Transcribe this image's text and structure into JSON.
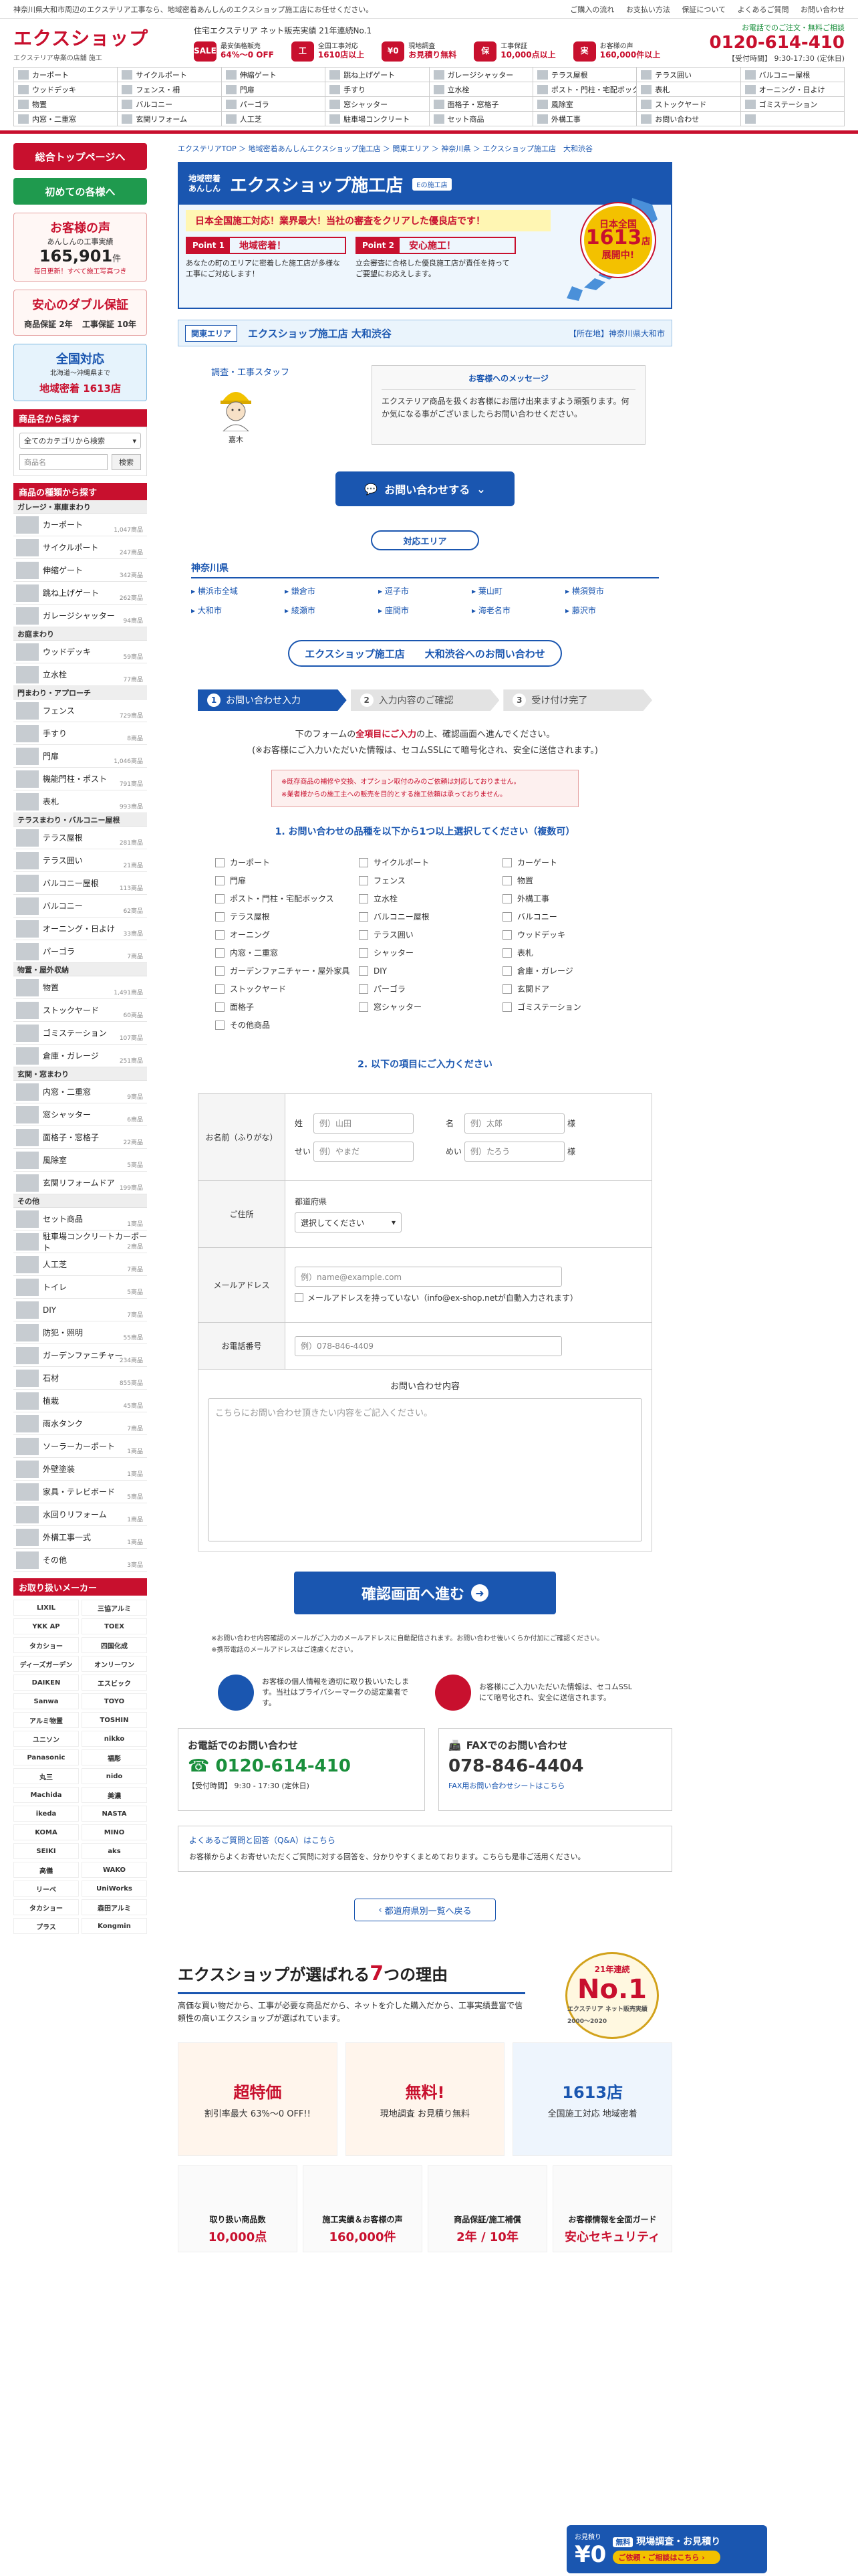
{
  "topbar": {
    "notice": "神奈川県大和市周辺のエクステリア工事なら、地域密着あんしんのエクスショップ施工店にお任せください。",
    "links": [
      "ご購入の流れ",
      "お支払い方法",
      "保証について",
      "よくあるご質問",
      "お問い合わせ"
    ]
  },
  "header": {
    "logo": "エクスショップ",
    "tagline": "エクステリア専業の店舗 施工",
    "award_line": "住宅エクステリア ネット販売実績 21年連続No.1",
    "stats": [
      {
        "icon": "SALE",
        "l1": "最安価格販売",
        "l2": "64%～0 OFF"
      },
      {
        "icon": "工",
        "l1": "全国工事対応",
        "l2": "1610店以上"
      },
      {
        "icon": "¥0",
        "l1": "現地調査",
        "l2": "お見積り無料"
      },
      {
        "icon": "保",
        "l1": "工事保証",
        "l2": "10,000点以上"
      },
      {
        "icon": "実",
        "l1": "お客様の声",
        "l2": "160,000件以上"
      }
    ],
    "phone_label": "お電話でのご注文・無料ご相談",
    "phone": "0120-614-410",
    "hours": "【受付時間】 9:30-17:30 (定休日)"
  },
  "catnav": [
    "カーポート",
    "サイクルポート",
    "伸縮ゲート",
    "跳ね上げゲート",
    "ガレージシャッター",
    "テラス屋根",
    "テラス囲い",
    "バルコニー屋根",
    "ウッドデッキ",
    "フェンス・柵",
    "門扉",
    "手すり",
    "立水栓",
    "ポスト・門柱・宅配ボックス",
    "表札",
    "オーニング・日よけ",
    "物置",
    "バルコニー",
    "パーゴラ",
    "窓シャッター",
    "面格子・窓格子",
    "風除室",
    "ストックヤード",
    "ゴミステーション",
    "内窓・二重窓",
    "玄関リフォーム",
    "人工芝",
    "駐車場コンクリート",
    "セット商品",
    "外構工事",
    "お問い合わせ",
    ""
  ],
  "sidebar": {
    "btn_top": "総合トップページへ",
    "btn_first": "初めての各様へ",
    "voice_title": "お客様の声",
    "voice_sub": "あんしんの工事実績",
    "voice_num": "165,901",
    "voice_unit": "件",
    "voice_note": "毎日更新！すべて施工写真つき",
    "guarantee_title": "安心のダブル保証",
    "guarantee_a": "商品保証 2年",
    "guarantee_b": "工事保証 10年",
    "national_title": "全国対応",
    "national_sub": "北海道〜沖縄県まで",
    "national_count": "地域密着 1613店",
    "search_head": "商品名から探す",
    "search_cat": "全てのカテゴリから検索",
    "search_ph": "商品名",
    "search_btn": "検索",
    "cat_head": "商品の種類から探す",
    "groups": [
      {
        "name": "ガレージ・車庫まわり",
        "items": [
          {
            "n": "カーポート",
            "c": "1,047商品"
          },
          {
            "n": "サイクルポート",
            "c": "247商品"
          },
          {
            "n": "伸縮ゲート",
            "c": "342商品"
          },
          {
            "n": "跳ね上げゲート",
            "c": "262商品"
          },
          {
            "n": "ガレージシャッター",
            "c": "94商品"
          }
        ]
      },
      {
        "name": "お庭まわり",
        "items": [
          {
            "n": "ウッドデッキ",
            "c": "59商品"
          },
          {
            "n": "立水栓",
            "c": "77商品"
          }
        ]
      },
      {
        "name": "門まわり・アプローチ",
        "items": [
          {
            "n": "フェンス",
            "c": "729商品"
          },
          {
            "n": "手すり",
            "c": "8商品"
          },
          {
            "n": "門扉",
            "c": "1,046商品"
          },
          {
            "n": "機能門柱・ポスト",
            "c": "791商品"
          },
          {
            "n": "表札",
            "c": "993商品"
          }
        ]
      },
      {
        "name": "テラスまわり・バルコニー屋根",
        "items": [
          {
            "n": "テラス屋根",
            "c": "281商品"
          },
          {
            "n": "テラス囲い",
            "c": "21商品"
          },
          {
            "n": "バルコニー屋根",
            "c": "113商品"
          },
          {
            "n": "バルコニー",
            "c": "62商品"
          },
          {
            "n": "オーニング・日よけ",
            "c": "33商品"
          },
          {
            "n": "パーゴラ",
            "c": "7商品"
          }
        ]
      },
      {
        "name": "物置・屋外収納",
        "items": [
          {
            "n": "物置",
            "c": "1,491商品"
          },
          {
            "n": "ストックヤード",
            "c": "60商品"
          },
          {
            "n": "ゴミステーション",
            "c": "107商品"
          },
          {
            "n": "倉庫・ガレージ",
            "c": "251商品"
          }
        ]
      },
      {
        "name": "玄関・窓まわり",
        "items": [
          {
            "n": "内窓・二重窓",
            "c": "9商品"
          },
          {
            "n": "窓シャッター",
            "c": "6商品"
          },
          {
            "n": "面格子・窓格子",
            "c": "22商品"
          },
          {
            "n": "風除室",
            "c": "5商品"
          },
          {
            "n": "玄関リフォームドア",
            "c": "199商品"
          }
        ]
      },
      {
        "name": "その他",
        "items": [
          {
            "n": "セット商品",
            "c": "1商品"
          },
          {
            "n": "駐車場コンクリートカーポート",
            "c": "2商品"
          },
          {
            "n": "人工芝",
            "c": "7商品"
          },
          {
            "n": "トイレ",
            "c": "5商品"
          },
          {
            "n": "DIY",
            "c": "7商品"
          },
          {
            "n": "防犯・照明",
            "c": "55商品"
          },
          {
            "n": "ガーデンファニチャー",
            "c": "234商品"
          },
          {
            "n": "石材",
            "c": "855商品"
          },
          {
            "n": "植栽",
            "c": "45商品"
          },
          {
            "n": "雨水タンク",
            "c": "7商品"
          },
          {
            "n": "ソーラーカーポート",
            "c": "1商品"
          },
          {
            "n": "外壁塗装",
            "c": "1商品"
          },
          {
            "n": "家具・テレビボード",
            "c": "5商品"
          },
          {
            "n": "水回りリフォーム",
            "c": "1商品"
          },
          {
            "n": "外構工事一式",
            "c": "1商品"
          },
          {
            "n": "その他",
            "c": "3商品"
          }
        ]
      }
    ],
    "makers_head": "お取り扱いメーカー",
    "makers": [
      "LIXIL",
      "三協アルミ",
      "YKK AP",
      "TOEX",
      "タカショー",
      "四国化成",
      "ディーズガーデン",
      "オンリーワン",
      "DAIKEN",
      "エスビック",
      "Sanwa",
      "TOYO",
      "アルミ物置",
      "TOSHIN",
      "ユニソン",
      "nikko",
      "Panasonic",
      "福彫",
      "丸三",
      "nido",
      "Machida",
      "美濃",
      "ikeda",
      "NASTA",
      "KOMA",
      "MINO",
      "SEIKI",
      "aks",
      "高儀",
      "WAKO",
      "リーベ",
      "UniWorks",
      "タカショー",
      "森田アルミ",
      "プラス",
      "Kongmin"
    ]
  },
  "main": {
    "breadcrumb": "エクステリアTOP ＞ 地域密着あんしんエクスショップ施工店 ＞ 関東エリア ＞ 神奈川県 ＞ エクスショップ施工店　大和渋谷",
    "hero": {
      "small1": "地域密着",
      "small2": "あんしん",
      "title": "エクスショップ施工店",
      "mark": "Eの施工店",
      "subtitle": "日本全国施工対応！業界最大！当社の審査をクリアした優良店です！",
      "p1_tag": "Point 1",
      "p1_title": "地域密着！",
      "p1_text": "あなたの町のエリアに密着した施工店が多様な工事にご対応します！",
      "p2_tag": "Point 2",
      "p2_title": "安心施工！",
      "p2_text": "立会審査に合格した優良施工店が責任を持ってご要望にお応えします。",
      "badge_top": "日本全国",
      "badge_num": "1613",
      "badge_unit": "店",
      "badge_bot": "展開中!"
    },
    "area": {
      "label": "関東エリア",
      "shop": "エクスショップ施工店",
      "name": "大和渋谷",
      "pref_label": "【所在地】",
      "pref": "神奈川県大和市"
    },
    "staff": {
      "caption": "調査・工事スタッフ",
      "name": "嘉木",
      "msg_title": "お客様へのメッセージ",
      "msg": "エクステリア商品を扱くお客様にお届け出来ますよう頑張ります。何か気になる事がございましたらお問い合わせください。"
    },
    "cta": "お問い合わせする",
    "area_pill": "対応エリア",
    "pref_name": "神奈川県",
    "cities": [
      "横浜市全域",
      "鎌倉市",
      "逗子市",
      "葉山町",
      "横須賀市",
      "大和市",
      "綾瀬市",
      "座間市",
      "海老名市",
      "藤沢市"
    ],
    "contact_title": "エクスショップ施工店　　大和渋谷へのお問い合わせ",
    "steps": [
      {
        "n": "1",
        "t": "お問い合わせ入力"
      },
      {
        "n": "2",
        "t": "入力内容のご確認"
      },
      {
        "n": "3",
        "t": "受け付け完了"
      }
    ],
    "intro1a": "下のフォームの",
    "intro1b": "全項目にご入力",
    "intro1c": "の上、確認画面へ進んでください。",
    "intro2": "(※お客様にご入力いただいた情報は、セコムSSLにて暗号化され、安全に送信されます。)",
    "warn1": "※既存商品の補修や交換、オプション取付のみのご依頼は対応しておりません。",
    "warn2": "※業者様からの施工主への販売を目的とする施工依頼は承っておりません。",
    "q1": "1. お問い合わせの品種を以下から1つ以上選択してください（複数可）",
    "checks": [
      "カーポート",
      "サイクルポート",
      "カーゲート",
      "門扉",
      "フェンス",
      "物置",
      "ポスト・門柱・宅配ボックス",
      "立水栓",
      "外構工事",
      "テラス屋根",
      "バルコニー屋根",
      "バルコニー",
      "オーニング",
      "テラス囲い",
      "ウッドデッキ",
      "内窓・二重窓",
      "シャッター",
      "表札",
      "ガーデンファニチャー・屋外家具",
      "DIY",
      "倉庫・ガレージ",
      "ストックヤード",
      "パーゴラ",
      "玄関ドア",
      "面格子",
      "窓シャッター",
      "ゴミステーション",
      "その他商品"
    ],
    "q2": "2. 以下の項目にご入力ください",
    "f_name": "お名前（ふりがな）",
    "f_sei": "姓",
    "f_mei": "名",
    "f_sei_ph": "例）山田",
    "f_mei_ph": "例）太郎",
    "f_sama": "様",
    "f_sei2": "せい",
    "f_mei2": "めい",
    "f_sei2_ph": "例）やまだ",
    "f_mei2_ph": "例）たろう",
    "f_addr": "ご住所",
    "f_pref_lbl": "都道府県",
    "f_pref_sel": "選択してください",
    "f_mail": "メールアドレス",
    "f_mail_ph": "例）name@example.com",
    "f_mail_chk": "メールアドレスを持っていない（info@ex-shop.netが自動入力されます）",
    "f_tel": "お電話番号",
    "f_tel_ph": "例）078-846-4409",
    "f_body_lbl": "お問い合わせ内容",
    "f_body_ph": "こちらにお問い合わせ頂きたい内容をご記入ください。",
    "submit": "確認画面へ進む",
    "notes": [
      "※お問い合わせ内容確認のメールがご入力のメールアドレスに自動配信されます。お問い合わせ後いくらか付加にご確認ください。",
      "※携帯電話のメールアドレスはご遠慮ください。"
    ],
    "sec1": "お客様の個人情報を適切に取り扱いいたします。当社はプライバシーマークの認定業者です。",
    "sec2": "お客様にご入力いただいた情報は、セコムSSLにて暗号化され、安全に送信されます。",
    "tel_title": "お電話でのお問い合わせ",
    "tel": "0120-614-410",
    "tel_hours": "【受付時間】 9:30 - 17:30 (定休日)",
    "fax_title": "FAXでのお問い合わせ",
    "fax": "078-846-4404",
    "fax_link": "FAX用お問い合わせシートはこちら",
    "faq_link": "よくあるご質問と回答（Q&A）はこちら",
    "faq_text": "お客様からよくお寄せいただくご質問に対する回答を、分かりやすくまとめております。こちらも是非ご活用ください。",
    "back": "都道府県別一覧へ戻る",
    "reasons_title_a": "エクスショップが選ばれる",
    "reasons_title_n": "7",
    "reasons_title_b": "つの理由",
    "reasons_desc": "高価な買い物だから、工事が必要な商品だから、ネットを介した購入だから、工事実績豊富で信頼性の高いエクスショップが選ばれています。",
    "no1_a": "21年連続",
    "no1_n": "No.1",
    "no1_b": "エクステリア ネット販売実績 2000〜2020",
    "cards": [
      {
        "t1": "超特価",
        "t2": "割引率最大 63%～0 OFF!!"
      },
      {
        "t1": "無料!",
        "t2": "現地調査 お見積り無料"
      },
      {
        "t1": "1613店",
        "t2": "全国施工対応 地域密着"
      }
    ],
    "cards2": [
      {
        "a": "取り扱い商品数",
        "b": "10,000点"
      },
      {
        "a": "施工実績＆お客様の声",
        "b": "160,000件"
      },
      {
        "a": "商品保証/施工補償",
        "b": "2年 / 10年"
      },
      {
        "a": "お客様情報を全面ガード",
        "b": "安心セキュリティ"
      }
    ],
    "float_yen": "¥0",
    "float_sm": "お見積り",
    "float_free": "無料",
    "float_t": "現場調査・お見積り",
    "float_btn": "ご依頼・ご相談はこちら ›"
  },
  "colors": {
    "brand_red": "#c8102e",
    "brand_blue": "#1a56b0",
    "green": "#1f9a4e"
  }
}
